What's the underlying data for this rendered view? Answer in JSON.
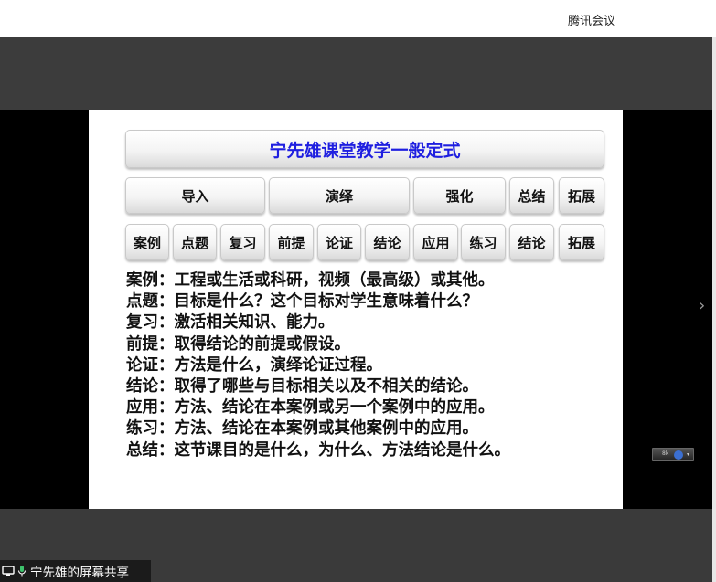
{
  "window": {
    "title": "腾讯会议"
  },
  "slide": {
    "title": "宁先雄课堂教学一般定式",
    "stages": [
      "导入",
      "演绎",
      "强化",
      "总结",
      "拓展"
    ],
    "steps": [
      "案例",
      "点题",
      "复习",
      "前提",
      "论证",
      "结论",
      "应用",
      "练习",
      "结论",
      "拓展"
    ],
    "lines": [
      "案例：工程或生活或科研，视频（最高级）或其他。",
      "点题：目标是什么？这个目标对学生意味着什么？",
      "复习：激活相关知识、能力。",
      "前提：取得结论的前提或假设。",
      "论证：方法是什么，演绎论证过程。",
      "结论：取得了哪些与目标相关以及不相关的结论。",
      "应用：方法、结论在本案例或另一个案例中的应用。",
      "练习：方法、结论在本案例或其他案例中的应用。",
      "总结：这节课目的是什么，为什么、方法结论是什么。"
    ]
  },
  "share_bar": {
    "label": "宁先雄的屏幕共享"
  },
  "mini_control": {
    "text": "8k"
  },
  "colors": {
    "title_text": "#1f1fe0",
    "share_bar_bg": "#1b1b1b",
    "stage_bg": "#000000",
    "app_bg": "#3a3a3a"
  },
  "icons": {
    "screen": "screen-share-icon",
    "mic": "microphone-icon",
    "next": "chevron-right-icon"
  }
}
